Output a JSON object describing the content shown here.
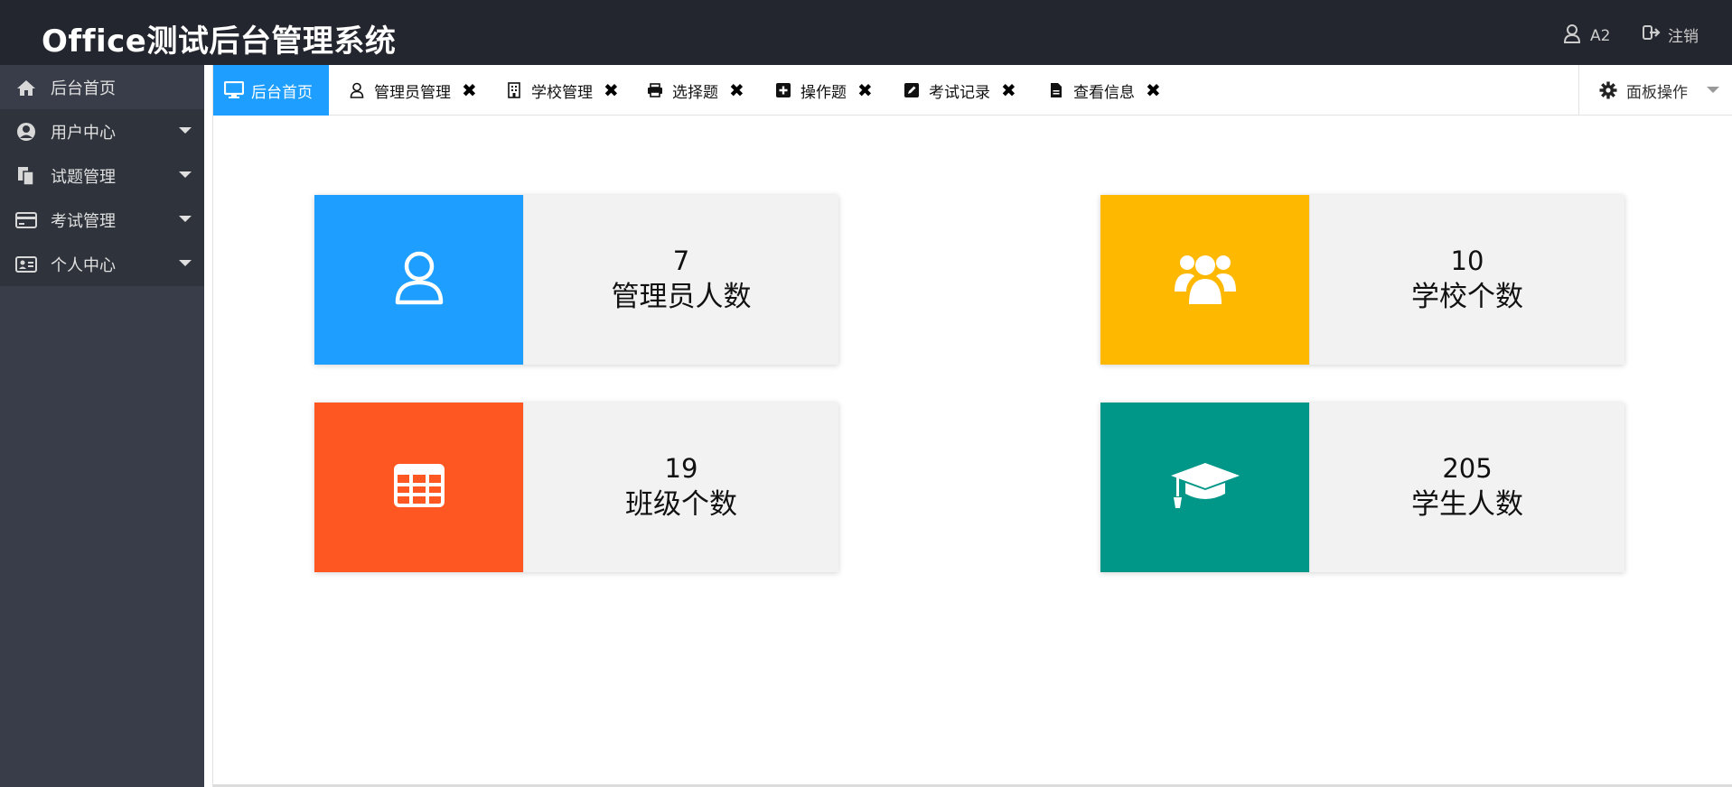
{
  "header": {
    "title": "Office测试后台管理系统",
    "username": "A2",
    "logout_label": "注销"
  },
  "sidebar": {
    "items": [
      {
        "label": "后台首页",
        "icon": "home-icon",
        "expandable": false
      },
      {
        "label": "用户中心",
        "icon": "user-circle-icon",
        "expandable": true
      },
      {
        "label": "试题管理",
        "icon": "copy-icon",
        "expandable": true
      },
      {
        "label": "考试管理",
        "icon": "credit-card-icon",
        "expandable": true
      },
      {
        "label": "个人中心",
        "icon": "id-card-icon",
        "expandable": true
      }
    ]
  },
  "tabs": [
    {
      "label": "后台首页",
      "icon": "monitor-icon",
      "active": true,
      "closable": false
    },
    {
      "label": "管理员管理",
      "icon": "user-outline-icon",
      "active": false,
      "closable": true
    },
    {
      "label": "学校管理",
      "icon": "building-icon",
      "active": false,
      "closable": true
    },
    {
      "label": "选择题",
      "icon": "print-icon",
      "active": false,
      "closable": true
    },
    {
      "label": "操作题",
      "icon": "plus-square-icon",
      "active": false,
      "closable": true
    },
    {
      "label": "考试记录",
      "icon": "edit-icon",
      "active": false,
      "closable": true
    },
    {
      "label": "查看信息",
      "icon": "file-icon",
      "active": false,
      "closable": true
    }
  ],
  "close_symbol": "✖",
  "panel_op_label": "面板操作",
  "cards": [
    {
      "value": "7",
      "label": "管理员人数",
      "color": "#1e9fff",
      "icon": "user-outline-icon"
    },
    {
      "value": "10",
      "label": "学校个数",
      "color": "#ffb800",
      "icon": "users-group-icon"
    },
    {
      "value": "19",
      "label": "班级个数",
      "color": "#ff5722",
      "icon": "table-icon"
    },
    {
      "value": "205",
      "label": "学生人数",
      "color": "#009688",
      "icon": "graduation-cap-icon"
    }
  ]
}
